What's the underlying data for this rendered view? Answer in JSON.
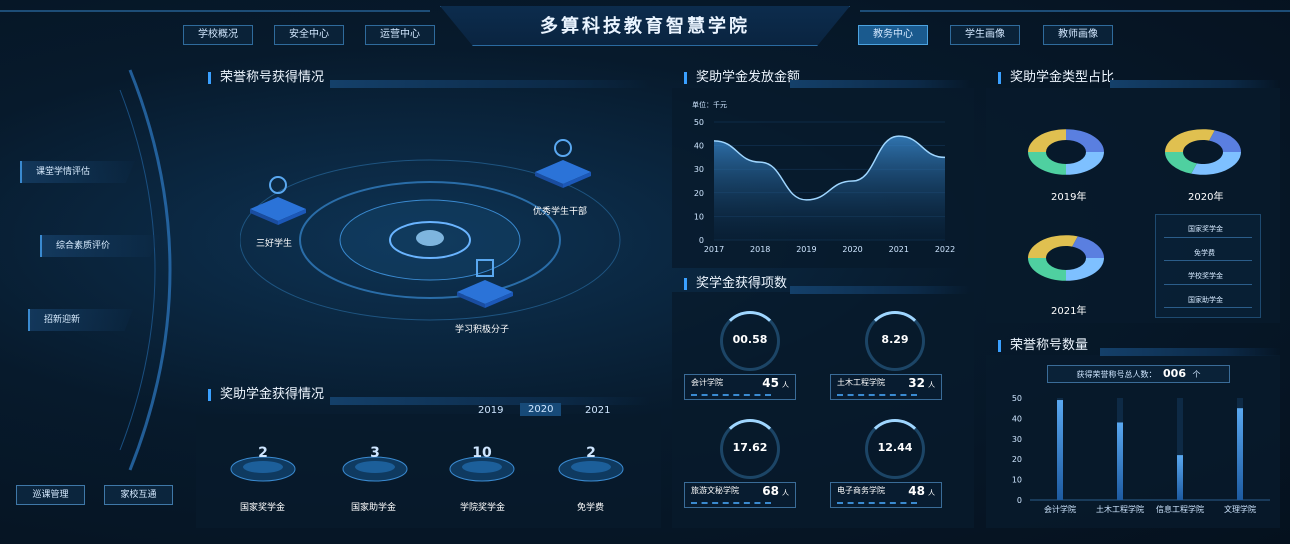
{
  "header": {
    "title": "多算科技教育智慧学院",
    "left_nav": [
      "学校概况",
      "安全中心",
      "运营中心"
    ],
    "right_nav": [
      "教务中心",
      "学生画像",
      "教师画像"
    ],
    "active": "教务中心"
  },
  "sidebar": {
    "items": [
      "课堂学情评估",
      "综合素质评价",
      "招新迎新"
    ],
    "bottom": [
      "巡课管理",
      "家校互通"
    ]
  },
  "honor": {
    "title": "荣誉称号获得情况",
    "nodes": [
      "三好学生",
      "优秀学生干部",
      "学习积极分子"
    ]
  },
  "scholarship": {
    "title": "奖助学金获得情况",
    "years": [
      "2019",
      "2020",
      "2021"
    ],
    "active_year": "2020",
    "items": [
      {
        "value": "2",
        "label": "国家奖学金"
      },
      {
        "value": "3",
        "label": "国家助学金"
      },
      {
        "value": "10",
        "label": "学院奖学金"
      },
      {
        "value": "2",
        "label": "免学费"
      }
    ]
  },
  "amount": {
    "title": "奖助学金发放金额",
    "unit": "单位：千元"
  },
  "chart_data": [
    {
      "type": "area",
      "title": "奖助学金发放金额",
      "x": [
        "2017",
        "2018",
        "2019",
        "2020",
        "2021",
        "2022"
      ],
      "values": [
        42,
        33,
        17,
        25,
        44,
        35
      ],
      "ylim": [
        0,
        50
      ],
      "yticks": [
        0,
        10,
        20,
        30,
        40,
        50
      ]
    },
    {
      "type": "bar",
      "title": "荣誉称号数量",
      "categories": [
        "会计学院",
        "土木工程学院",
        "信息工程学院",
        "文理学院"
      ],
      "values": [
        49,
        38,
        22,
        45
      ],
      "ylim": [
        0,
        50
      ],
      "yticks": [
        0,
        10,
        20,
        30,
        40,
        50
      ]
    }
  ],
  "awards": {
    "title": "奖学金获得项数",
    "items": [
      {
        "pct": "00.58",
        "college": "会计学院",
        "count": "45",
        "unit": "人"
      },
      {
        "pct": "8.29",
        "college": "土木工程学院",
        "count": "32",
        "unit": "人"
      },
      {
        "pct": "17.62",
        "college": "旅游文秘学院",
        "count": "68",
        "unit": "人"
      },
      {
        "pct": "12.44",
        "college": "电子商务学院",
        "count": "48",
        "unit": "人"
      }
    ]
  },
  "types": {
    "title": "奖助学金类型占比",
    "years": [
      "2019年",
      "2020年",
      "2021年"
    ],
    "legend": [
      "国家奖学金",
      "免学费",
      "学校奖学金",
      "国家助学金"
    ],
    "colors": [
      "#5a8fe0",
      "#5a8fe0",
      "#4fd0a0",
      "#e0c050"
    ]
  },
  "honorcount": {
    "title": "荣誉称号数量",
    "total_label": "获得荣誉称号总人数：",
    "total": "006",
    "total_unit": "个"
  },
  "colors": {
    "accent": "#3aa0ff",
    "bar": "#3b8be0"
  }
}
